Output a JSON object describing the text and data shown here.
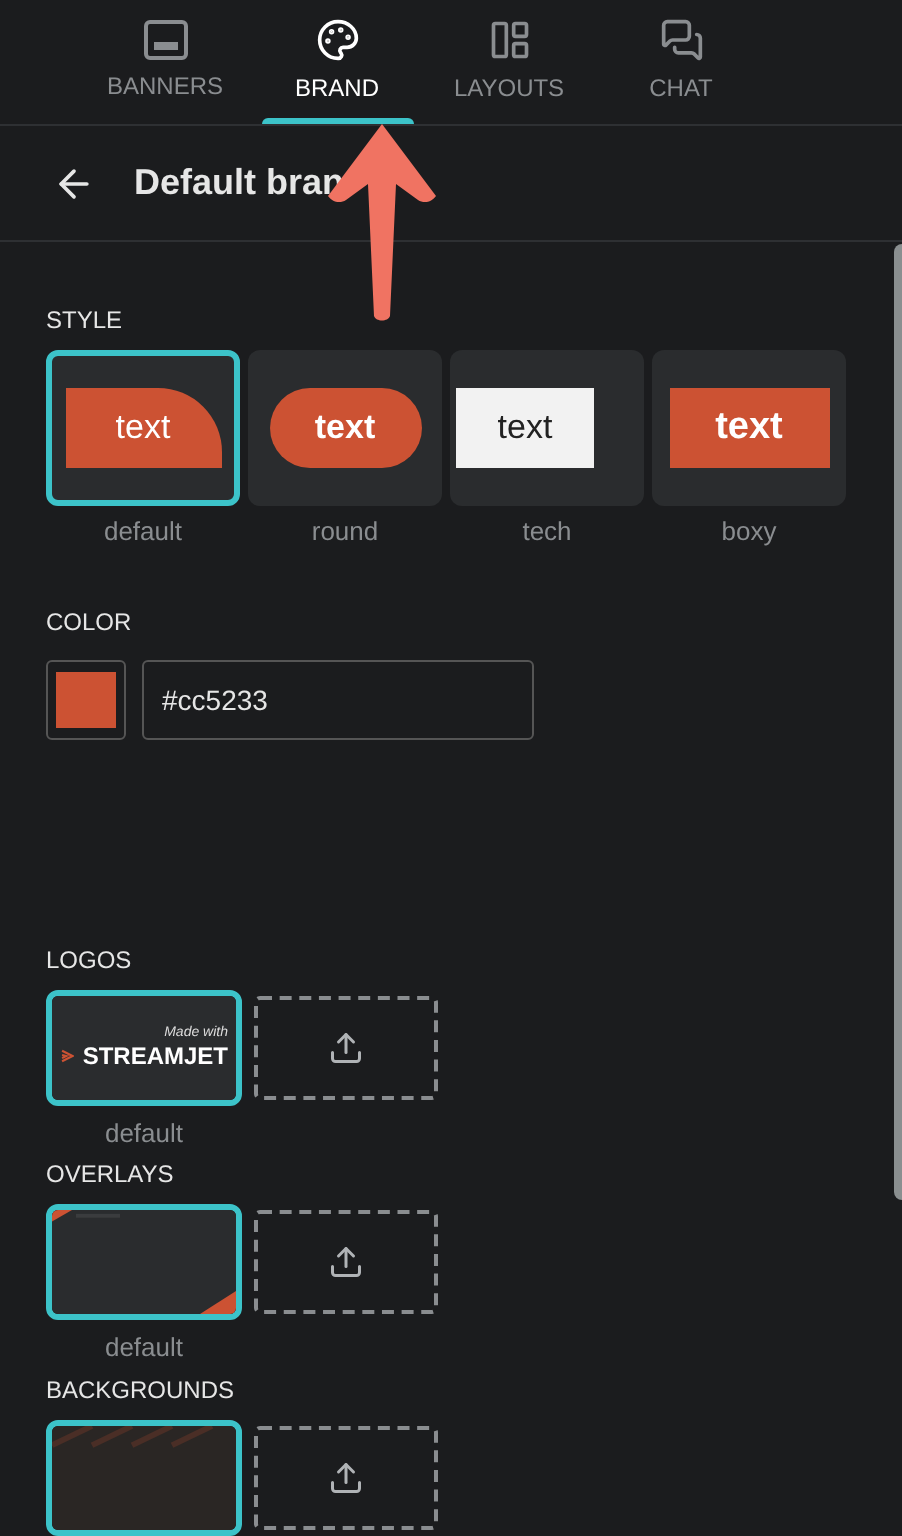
{
  "tabs": [
    {
      "kind": "banners",
      "label": "BANNERS",
      "selected": false
    },
    {
      "kind": "brand",
      "label": "BRAND",
      "selected": true
    },
    {
      "kind": "layouts",
      "label": "LAYOUTS",
      "selected": false
    },
    {
      "kind": "chat",
      "label": "CHAT",
      "selected": false
    }
  ],
  "header": {
    "title": "Default bran"
  },
  "style": {
    "heading": "STYLE",
    "options": [
      {
        "kind": "default",
        "sample": "text",
        "label": "default",
        "selected": true
      },
      {
        "kind": "round",
        "sample": "text",
        "label": "round",
        "selected": false
      },
      {
        "kind": "tech",
        "sample": "text",
        "label": "tech",
        "selected": false
      },
      {
        "kind": "boxy",
        "sample": "text",
        "label": "boxy",
        "selected": false
      }
    ]
  },
  "color": {
    "heading": "COLOR",
    "color": "#cc5233",
    "value": "#cc5233"
  },
  "logos": {
    "heading": "LOGOS",
    "items": [
      {
        "kind": "logo",
        "tagline": "Made with",
        "brand": "STREAMJET",
        "label": "default",
        "selected": true
      }
    ]
  },
  "overlays": {
    "heading": "OVERLAYS",
    "items": [
      {
        "kind": "overlay",
        "label": "default",
        "selected": true
      }
    ]
  },
  "backgrounds": {
    "heading": "BACKGROUNDS",
    "items": [
      {
        "kind": "background",
        "selected": true
      }
    ]
  }
}
